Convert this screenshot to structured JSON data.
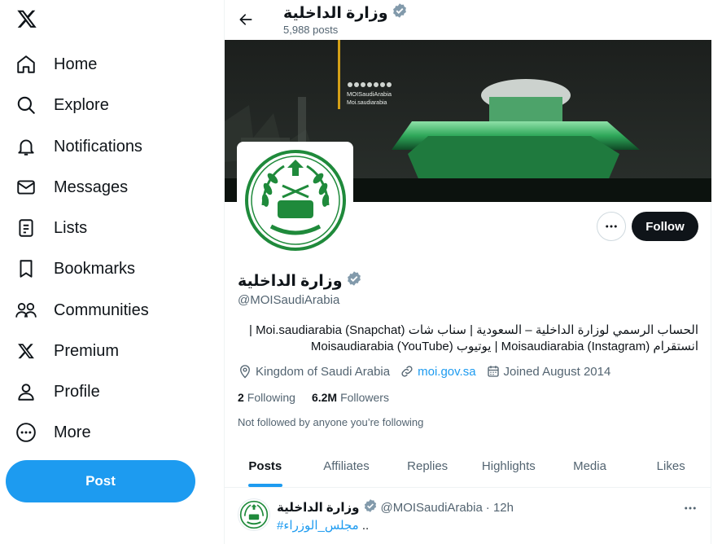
{
  "sidebar": {
    "items": [
      {
        "label": "Home",
        "icon": "home-icon"
      },
      {
        "label": "Explore",
        "icon": "search-icon"
      },
      {
        "label": "Notifications",
        "icon": "bell-icon"
      },
      {
        "label": "Messages",
        "icon": "envelope-icon"
      },
      {
        "label": "Lists",
        "icon": "list-icon"
      },
      {
        "label": "Bookmarks",
        "icon": "bookmark-icon"
      },
      {
        "label": "Communities",
        "icon": "people-icon"
      },
      {
        "label": "Premium",
        "icon": "x-logo-icon"
      },
      {
        "label": "Profile",
        "icon": "person-icon"
      },
      {
        "label": "More",
        "icon": "more-circle-icon"
      }
    ],
    "post_label": "Post"
  },
  "header": {
    "name": "وزارة الداخلية",
    "posts_count": "5,988 posts"
  },
  "banner": {
    "handle": "MOISaudiArabia",
    "site": "Moi.saudiarabia"
  },
  "profile": {
    "name": "وزارة الداخلية",
    "handle": "@MOISaudiArabia",
    "bio_line1": "الحساب الرسمي لوزارة الداخلية – السعودية | سناب شات (Snapchat) Moi.saudiarabia |",
    "bio_line2": "انستقرام (Instagram) Moisaudiarabia | يوتيوب (YouTube) Moisaudiarabia",
    "location": "Kingdom of Saudi Arabia",
    "website": "moi.gov.sa",
    "joined": "Joined August 2014",
    "following_count": "2",
    "following_label": "Following",
    "followers_count": "6.2M",
    "followers_label": "Followers",
    "not_followed": "Not followed by anyone you’re following",
    "follow_label": "Follow"
  },
  "tabs": [
    "Posts",
    "Affiliates",
    "Replies",
    "Highlights",
    "Media",
    "Likes"
  ],
  "tweet": {
    "name": "وزارة الداخلية",
    "handle": "@MOISaudiArabia",
    "time": "· 12h",
    "hashtag": "#مجلس_الوزراء",
    "text_suffix": ".."
  },
  "colors": {
    "accent": "#1d9bf0",
    "verified": "#829aab",
    "emblem_green": "#1f8a3b"
  }
}
